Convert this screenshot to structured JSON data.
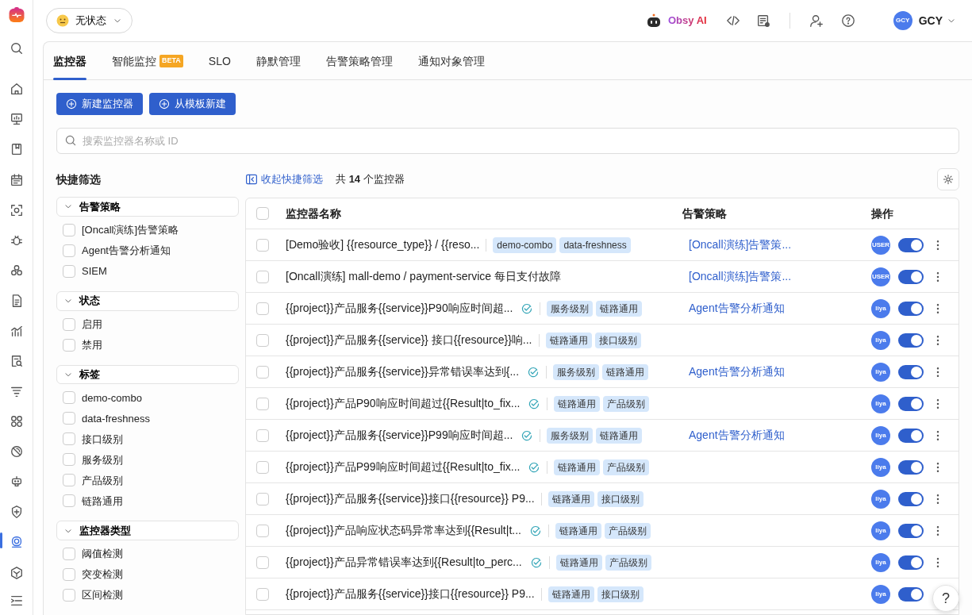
{
  "status_menu": {
    "label": "无状态"
  },
  "header": {
    "ai_label": "Obsy AI",
    "user_avatar": "GCY",
    "user_name": "GCY"
  },
  "sidebar": {
    "items": [
      {
        "selected": false
      },
      {
        "selected": false
      },
      {
        "selected": false
      },
      {
        "selected": false
      },
      {
        "selected": false
      },
      {
        "selected": false
      },
      {
        "selected": false
      },
      {
        "selected": false
      },
      {
        "selected": false
      },
      {
        "selected": false
      },
      {
        "selected": false
      },
      {
        "selected": false
      },
      {
        "selected": false
      },
      {
        "selected": false
      },
      {
        "selected": false
      },
      {
        "selected": true
      },
      {
        "selected": false
      }
    ]
  },
  "tabs": [
    {
      "label": "监控器",
      "selected": true
    },
    {
      "label": "智能监控",
      "badge": "BETA",
      "selected": false
    },
    {
      "label": "SLO",
      "selected": false
    },
    {
      "label": "静默管理",
      "selected": false
    },
    {
      "label": "告警策略管理",
      "selected": false
    },
    {
      "label": "通知对象管理",
      "selected": false
    }
  ],
  "actions": [
    "新建监控器",
    "从模板新建"
  ],
  "search": {
    "placeholder": "搜索监控器名称或 ID"
  },
  "quick_filter": {
    "title": "快捷筛选",
    "collapse_label": "收起快捷筛选",
    "count_prefix": "共",
    "count": "14",
    "count_suffix": "个监控器",
    "sections": [
      {
        "title": "告警策略",
        "expanded": true,
        "options": [
          {
            "label": "[Oncall演练]告警策略",
            "checked": false
          },
          {
            "label": "Agent告警分析通知",
            "checked": false
          },
          {
            "label": "SIEM",
            "checked": false
          }
        ]
      },
      {
        "title": "状态",
        "expanded": true,
        "options": [
          {
            "label": "启用",
            "checked": false
          },
          {
            "label": "禁用",
            "checked": false
          }
        ]
      },
      {
        "title": "标签",
        "expanded": true,
        "options": [
          {
            "label": "demo-combo",
            "checked": false
          },
          {
            "label": "data-freshness",
            "checked": false
          },
          {
            "label": "接口级别",
            "checked": false
          },
          {
            "label": "服务级别",
            "checked": false
          },
          {
            "label": "产品级别",
            "checked": false
          },
          {
            "label": "链路通用",
            "checked": false
          }
        ]
      },
      {
        "title": "监控器类型",
        "expanded": true,
        "options": [
          {
            "label": "阈值检测",
            "checked": false
          },
          {
            "label": "突变检测",
            "checked": false
          },
          {
            "label": "区间检测",
            "checked": false
          }
        ]
      }
    ]
  },
  "table": {
    "columns": [
      "监控器名称",
      "告警策略",
      "操作"
    ],
    "header_checked": false,
    "rows": [
      {
        "checked": false,
        "name": "[Demo验收] {{resource_type}} / {{reso...",
        "synced": false,
        "tags": [
          "demo-combo",
          "data-freshness"
        ],
        "policy": "[Oncall演练]告警策...",
        "owner": "USER",
        "enabled": true
      },
      {
        "checked": false,
        "name": "[Oncall演练] mall-demo / payment-service 每日支付故障",
        "synced": false,
        "tags": [],
        "policy": "[Oncall演练]告警策...",
        "owner": "USER",
        "enabled": true
      },
      {
        "checked": false,
        "name": "{{project}}产品服务{{service}}P90响应时间超...",
        "synced": true,
        "tags": [
          "服务级别",
          "链路通用"
        ],
        "policy": "Agent告警分析通知",
        "owner": "liya",
        "enabled": true
      },
      {
        "checked": false,
        "name": "{{project}}产品服务{{service}} 接口{{resource}}响...",
        "synced": false,
        "tags": [
          "链路通用",
          "接口级别"
        ],
        "owner": "liya",
        "enabled": true
      },
      {
        "checked": false,
        "name": "{{project}}产品服务{{service}}异常错误率达到{...",
        "synced": true,
        "tags": [
          "服务级别",
          "链路通用"
        ],
        "policy": "Agent告警分析通知",
        "owner": "liya",
        "enabled": true
      },
      {
        "checked": false,
        "name": "{{project}}产品P90响应时间超过{{Result|to_fix...",
        "synced": true,
        "tags": [
          "链路通用",
          "产品级别"
        ],
        "owner": "liya",
        "enabled": true
      },
      {
        "checked": false,
        "name": "{{project}}产品服务{{service}}P99响应时间超...",
        "synced": true,
        "tags": [
          "服务级别",
          "链路通用"
        ],
        "policy": "Agent告警分析通知",
        "owner": "liya",
        "enabled": true
      },
      {
        "checked": false,
        "name": "{{project}}产品P99响应时间超过{{Result|to_fix...",
        "synced": true,
        "tags": [
          "链路通用",
          "产品级别"
        ],
        "owner": "liya",
        "enabled": true
      },
      {
        "checked": false,
        "name": "{{project}}产品服务{{service}}接口{{resource}} P9...",
        "synced": false,
        "tags": [
          "链路通用",
          "接口级别"
        ],
        "owner": "liya",
        "enabled": true
      },
      {
        "checked": false,
        "name": "{{project}}产品响应状态码异常率达到{{Result|t...",
        "synced": true,
        "tags": [
          "链路通用",
          "产品级别"
        ],
        "owner": "liya",
        "enabled": true
      },
      {
        "checked": false,
        "name": "{{project}}产品异常错误率达到{{Result|to_perc...",
        "synced": true,
        "tags": [
          "链路通用",
          "产品级别"
        ],
        "owner": "liya",
        "enabled": true
      },
      {
        "checked": false,
        "name": "{{project}}产品服务{{service}}接口{{resource}} P9...",
        "synced": false,
        "tags": [
          "链路通用",
          "接口级别"
        ],
        "owner": "liya",
        "enabled": true
      }
    ]
  },
  "help_button": {
    "label": "?"
  }
}
